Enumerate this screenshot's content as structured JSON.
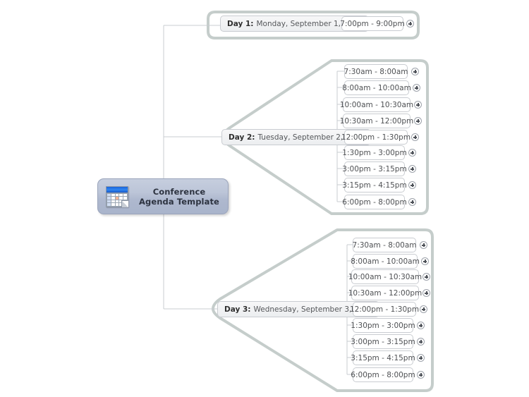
{
  "root": {
    "label": "Conference Agenda Template",
    "icon": "calendar-icon"
  },
  "colors": {
    "group_outline": "#c5cdcb",
    "connector": "#c9ccd1",
    "root_fill": "#b4bed2",
    "node_border": "#c9ccd1",
    "calendar_header": "#2f86f2",
    "calendar_highlight": "#f3b596"
  },
  "branches": [
    {
      "id": "day-1",
      "day_label": "Day 1:",
      "date": "Monday, September 1, 2008",
      "times": [
        {
          "label": "7:00pm - 9:00pm",
          "expand": "+"
        }
      ]
    },
    {
      "id": "day-2",
      "day_label": "Day 2:",
      "date": "Tuesday, September 2, 2008",
      "times": [
        {
          "label": "7:30am - 8:00am",
          "expand": "+"
        },
        {
          "label": "8:00am - 10:00am",
          "expand": "+"
        },
        {
          "label": "10:00am - 10:30am",
          "expand": "+"
        },
        {
          "label": "10:30am - 12:00pm",
          "expand": "+"
        },
        {
          "label": "12:00pm - 1:30pm",
          "expand": "+"
        },
        {
          "label": "1:30pm - 3:00pm",
          "expand": "+"
        },
        {
          "label": "3:00pm - 3:15pm",
          "expand": "+"
        },
        {
          "label": "3:15pm - 4:15pm",
          "expand": "+"
        },
        {
          "label": "6:00pm - 8:00pm",
          "expand": "+"
        }
      ]
    },
    {
      "id": "day-3",
      "day_label": "Day 3:",
      "date": "Wednesday, September 3, 2008",
      "times": [
        {
          "label": "7:30am - 8:00am",
          "expand": "+"
        },
        {
          "label": "8:00am - 10:00am",
          "expand": "+"
        },
        {
          "label": "10:00am - 10:30am",
          "expand": "+"
        },
        {
          "label": "10:30am - 12:00pm",
          "expand": "+"
        },
        {
          "label": "12:00pm - 1:30pm",
          "expand": "+"
        },
        {
          "label": "1:30pm - 3:00pm",
          "expand": "+"
        },
        {
          "label": "3:00pm - 3:15pm",
          "expand": "+"
        },
        {
          "label": "3:15pm - 4:15pm",
          "expand": "+"
        },
        {
          "label": "6:00pm - 8:00pm",
          "expand": "+"
        }
      ]
    }
  ]
}
